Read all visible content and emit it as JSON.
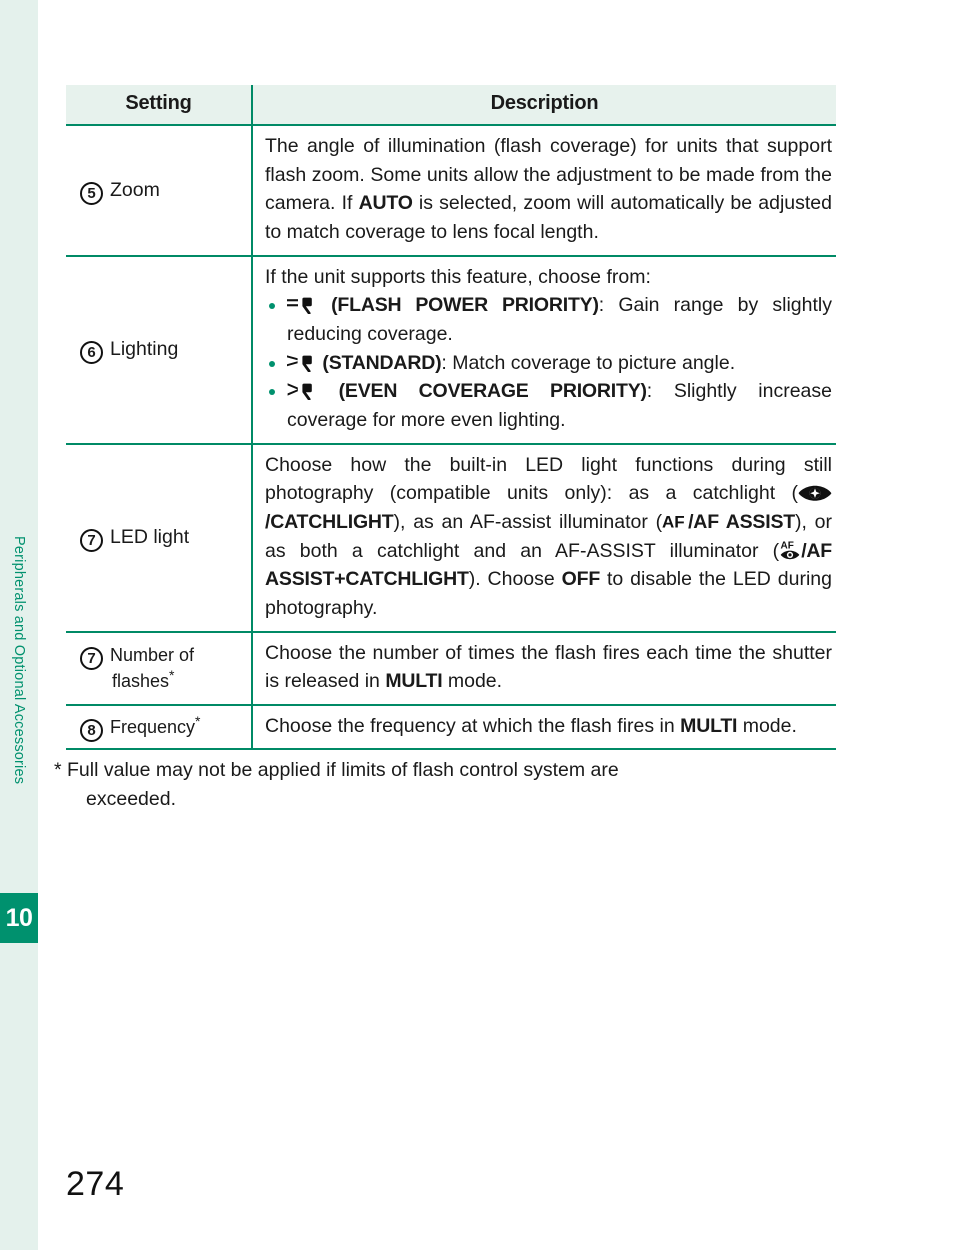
{
  "sidebar": {
    "section_title": "Peripherals and Optional Accessories",
    "chapter_number": "10",
    "band_color": "#e4f1ec",
    "accent_color": "#00916e"
  },
  "page": {
    "number": "274"
  },
  "table": {
    "headers": {
      "setting": "Setting",
      "description": "Description"
    },
    "rows": [
      {
        "num": "5",
        "setting": "Zoom",
        "desc_pre": "The angle of illumination (flash coverage) for units that support flash zoom. Some units allow the adjustment to be made from the camera. If ",
        "desc_kw": "AUTO",
        "desc_post": " is selected, zoom will automatically be adjusted to match coverage to lens focal length."
      },
      {
        "num": "6",
        "setting": "Lighting",
        "intro": "If the unit supports this feature, choose from:",
        "options": [
          {
            "icon": "flash-power-priority-icon",
            "label": "(FLASH POWER PRIORITY)",
            "text": ": Gain range by slightly reducing coverage."
          },
          {
            "icon": "flash-standard-icon",
            "label": "(STANDARD)",
            "text": ": Match coverage to picture angle."
          },
          {
            "icon": "flash-even-coverage-icon",
            "label": "(EVEN COVERAGE PRIORITY)",
            "text": ": Slightly increase coverage for more even lighting."
          }
        ]
      },
      {
        "num": "7",
        "setting": "LED light",
        "seg1": "Choose how the built-in LED light functions during still photography (compatible units only): as a catchlight (",
        "catchlight_kw": "/CATCHLIGHT",
        "seg2": "), as an AF-assist illuminator (",
        "afassist_kw": "/AF ASSIST",
        "seg3": "), or as both a catchlight and an AF-ASSIST illuminator (",
        "both_kw": "/AF ASSIST+CATCHLIGHT",
        "seg4": "). Choose ",
        "off_kw": "OFF",
        "seg5": " to disable the LED during photography."
      },
      {
        "num": "7",
        "setting_line1": "Number of",
        "setting_line2": "flashes",
        "has_star": true,
        "desc_pre": "Choose the number of times the flash fires each time the shutter is released in ",
        "desc_kw": "MULTI",
        "desc_post": " mode."
      },
      {
        "num": "8",
        "setting": "Frequency",
        "has_star": true,
        "desc_pre": "Choose the frequency at which the flash fires in ",
        "desc_kw": "MULTI",
        "desc_post": " mode."
      }
    ]
  },
  "footnote": {
    "marker": "*",
    "line1": "Full value may not be applied if limits of flash control system are",
    "line2": "exceeded."
  }
}
